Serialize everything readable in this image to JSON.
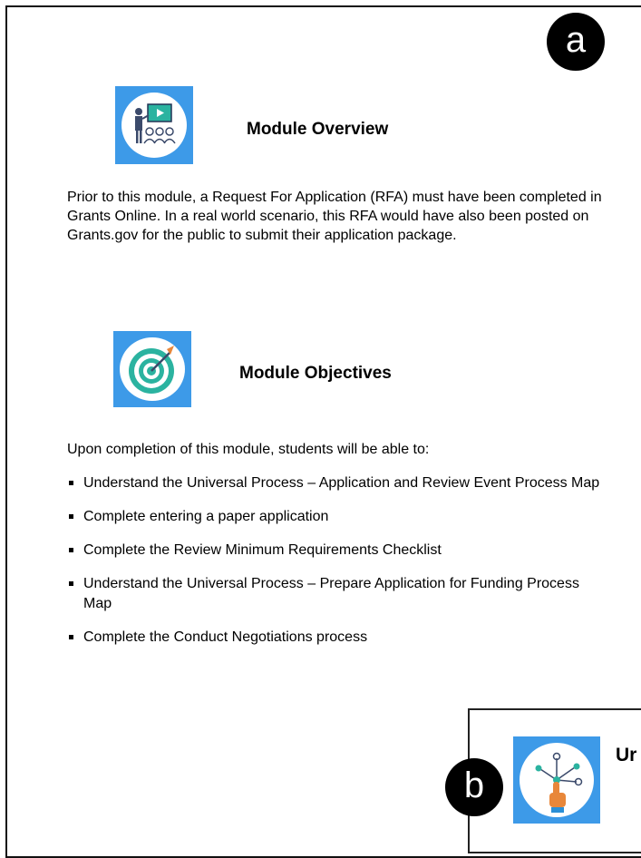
{
  "badges": {
    "a": "a",
    "b": "b"
  },
  "overview": {
    "title": "Module Overview",
    "icon": "presentation-icon",
    "paragraph": "Prior to this module, a Request For Application (RFA) must have been completed in Grants Online.  In a real world scenario, this RFA would have also been posted on Grants.gov for the public to submit their application package."
  },
  "objectives": {
    "title": "Module Objectives",
    "icon": "target-icon",
    "intro": "Upon completion of this module, students will be able to:",
    "items": [
      "Understand the Universal Process – Application and Review Event Process Map",
      "Complete entering a paper application",
      "Complete the Review Minimum Requirements Checklist",
      "Understand the Universal Process – Prepare Application for Funding Process Map",
      "Complete the Conduct Negotiations process"
    ]
  },
  "card": {
    "title_fragment": "Ur",
    "icon": "touch-network-icon"
  },
  "colors": {
    "tile_blue": "#3d9ae8",
    "target_teal": "#2bb3a0",
    "arrow_orange": "#e8873a"
  }
}
